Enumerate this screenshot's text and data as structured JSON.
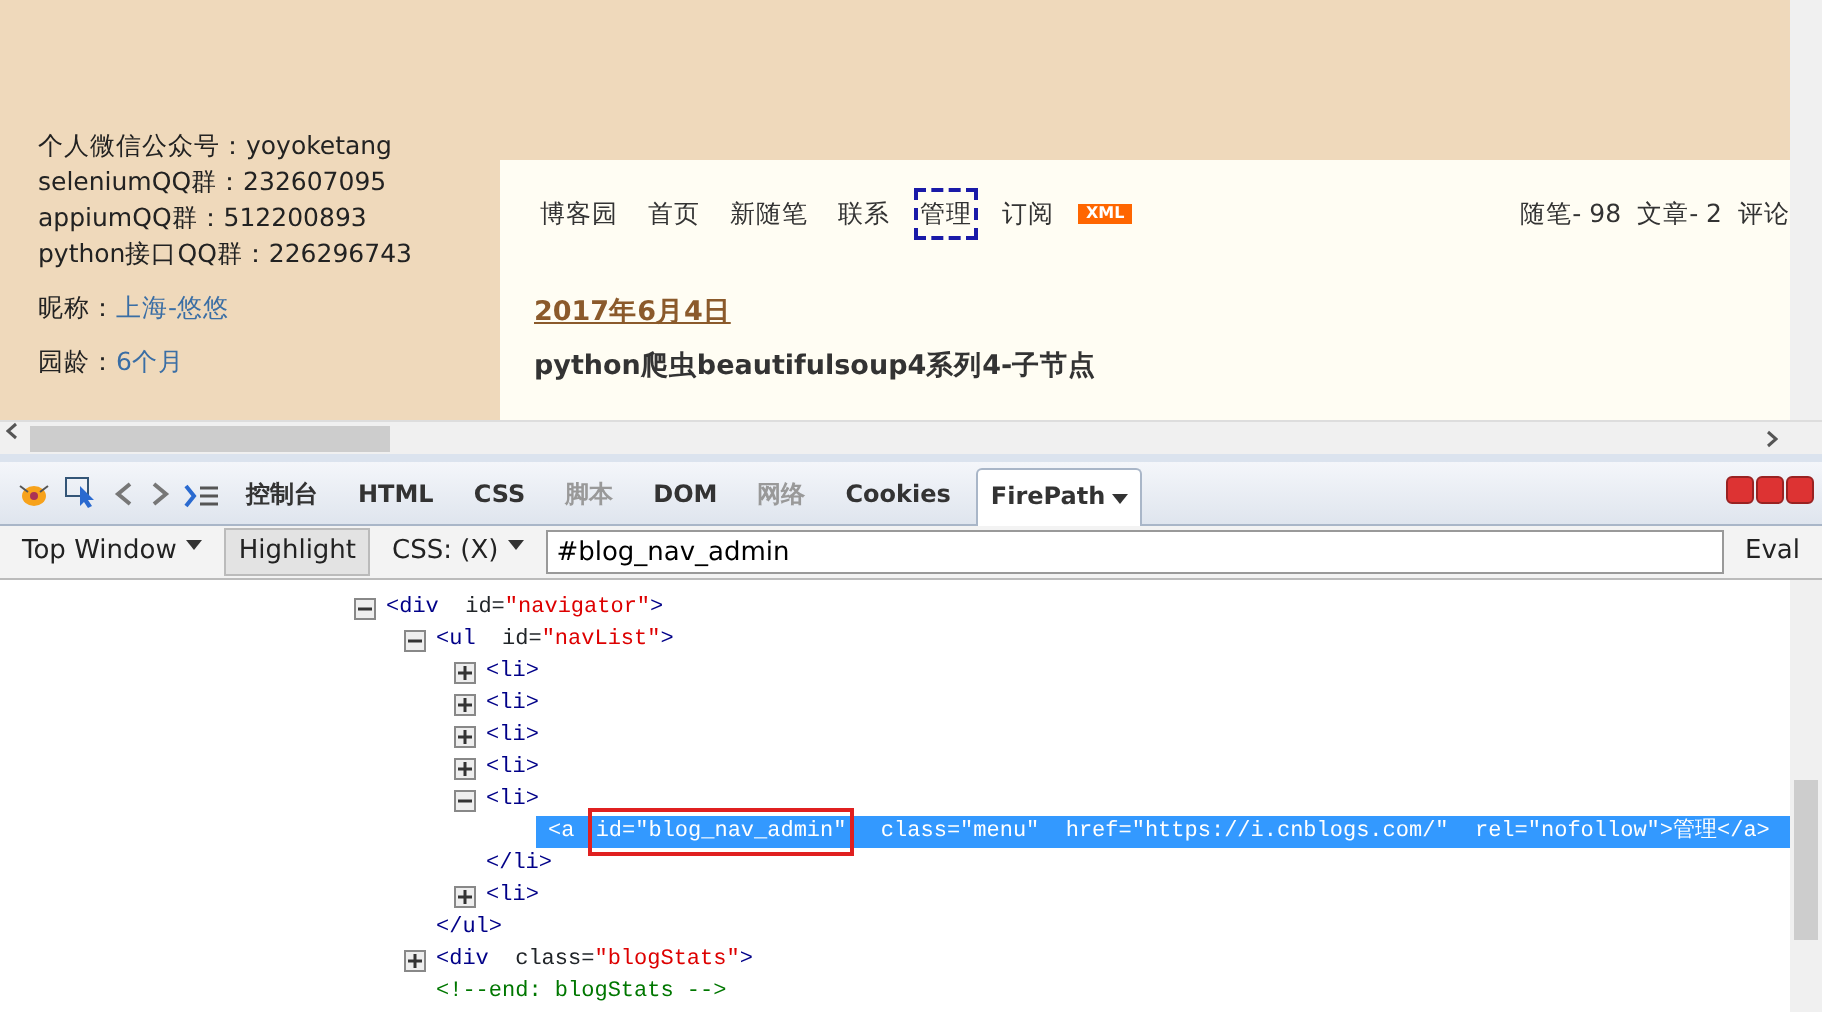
{
  "page": {
    "sidebar_lines": [
      "个人微信公众号：yoyoketang",
      "seleniumQQ群：232607095",
      "appiumQQ群：512200893",
      "python接口QQ群：226296743"
    ],
    "profile": [
      {
        "label": "昵称：",
        "value": "上海-悠悠"
      },
      {
        "label": "园龄：",
        "value": "6个月"
      }
    ],
    "nav": [
      {
        "label": "博客园",
        "highlighted": false
      },
      {
        "label": "首页",
        "highlighted": false
      },
      {
        "label": "新随笔",
        "highlighted": false
      },
      {
        "label": "联系",
        "highlighted": false
      },
      {
        "label": "管理",
        "highlighted": true
      },
      {
        "label": "订阅",
        "highlighted": false
      }
    ],
    "xml_badge": "XML",
    "stats": [
      "随笔- 98",
      "文章- 2",
      "评论"
    ],
    "post_date": "2017年6月4日",
    "post_title": "python爬虫beautifulsoup4系列4-子节点"
  },
  "firebug": {
    "tabs": [
      {
        "label": "控制台",
        "selected": false,
        "disabled": false
      },
      {
        "label": "HTML",
        "selected": false,
        "disabled": false
      },
      {
        "label": "CSS",
        "selected": false,
        "disabled": false
      },
      {
        "label": "脚本",
        "selected": false,
        "disabled": true
      },
      {
        "label": "DOM",
        "selected": false,
        "disabled": false
      },
      {
        "label": "网络",
        "selected": false,
        "disabled": true
      },
      {
        "label": "Cookies",
        "selected": false,
        "disabled": false
      },
      {
        "label": "FirePath",
        "selected": true,
        "disabled": false
      }
    ],
    "toolbar": {
      "context": "Top Window",
      "highlight": {
        "label": "Highlight",
        "pressed": true
      },
      "mode": "CSS: (X)",
      "query": "#blog_nav_admin",
      "eval": "Eval"
    },
    "tree": [
      {
        "kind": "element",
        "markup": "<div  id=\"navigator\">",
        "expanded": true,
        "children": [
          {
            "kind": "element",
            "markup": "<ul  id=\"navList\">",
            "expanded": true,
            "children": [
              {
                "kind": "element",
                "markup": "<li>",
                "expanded": false
              },
              {
                "kind": "element",
                "markup": "<li>",
                "expanded": false
              },
              {
                "kind": "element",
                "markup": "<li>",
                "expanded": false
              },
              {
                "kind": "element",
                "markup": "<li>",
                "expanded": false
              },
              {
                "kind": "element",
                "markup": "<li>",
                "expanded": true,
                "children": [
                  {
                    "kind": "selected",
                    "parts": [
                      {
                        "text": "<a ",
                        "boxed": false
                      },
                      {
                        "text": "id=\"blog_nav_admin\"",
                        "boxed": true
                      },
                      {
                        "text": "  class=\"menu\"  href=\"https://i.cnblogs.com/\"  rel=\"nofollow\">管理</a>",
                        "boxed": false
                      }
                    ]
                  }
                ]
              },
              {
                "kind": "close",
                "markup": "</li>"
              },
              {
                "kind": "element",
                "markup": "<li>",
                "expanded": false
              }
            ]
          },
          {
            "kind": "close",
            "markup": "</ul>"
          },
          {
            "kind": "element",
            "markup": "<div  class=\"blogStats\">",
            "expanded": false
          },
          {
            "kind": "comment",
            "markup": "<!--end: blogStats -->"
          }
        ]
      }
    ]
  }
}
